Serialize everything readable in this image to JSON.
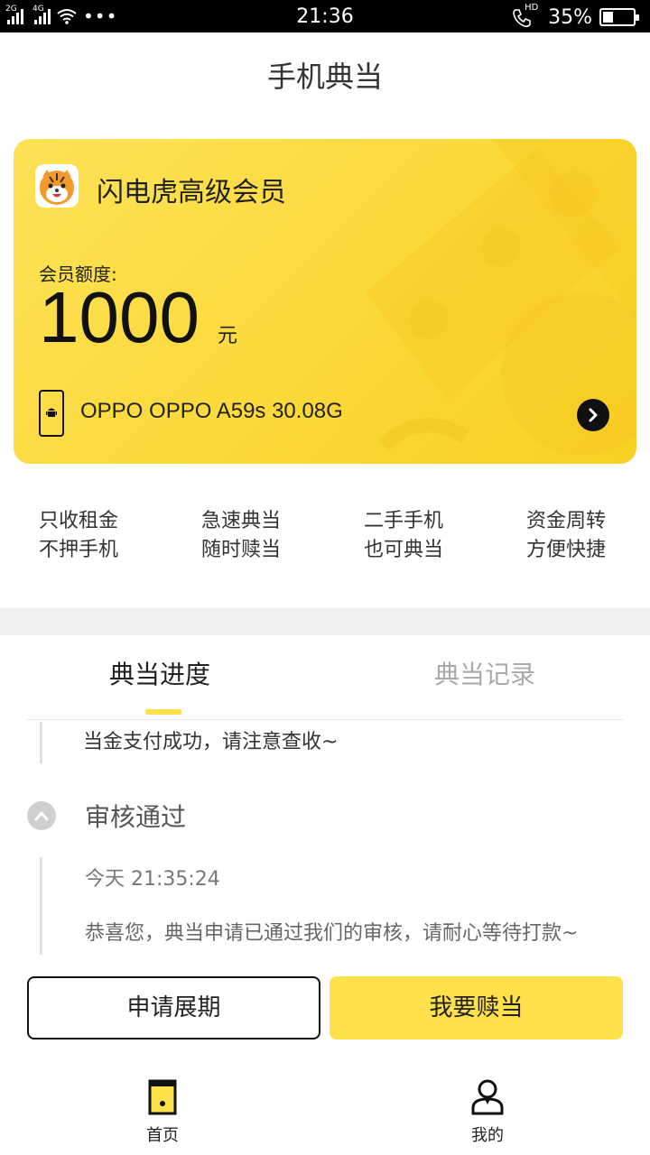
{
  "status_bar": {
    "network_1": "2G",
    "network_2": "4G",
    "dots": "•••",
    "time": "21:36",
    "call_label": "HD",
    "battery": "35%",
    "battery_level": 0.35
  },
  "header": {
    "title": "手机典当"
  },
  "card": {
    "title": "闪电虎高级会员",
    "quota_label": "会员额度:",
    "quota_value": "1000",
    "quota_unit": "元",
    "device": "OPPO OPPO A59s 30.08G",
    "accent": "#fde04a"
  },
  "features": [
    {
      "line1": "只收租金",
      "line2": "不押手机"
    },
    {
      "line1": "急速典当",
      "line2": "随时赎当"
    },
    {
      "line1": "二手手机",
      "line2": "也可典当"
    },
    {
      "line1": "资金周转",
      "line2": "方便快捷"
    }
  ],
  "tabs": [
    {
      "label": "典当进度"
    },
    {
      "label": "典当记录"
    }
  ],
  "timeline": {
    "prev_message": "当金支付成功，请注意查收~",
    "status": "审核通过",
    "time": "今天 21:35:24",
    "description": "恭喜您，典当申请已通过我们的审核，请耐心等待打款~"
  },
  "actions": {
    "extend_label": "申请展期",
    "redeem_label": "我要赎当"
  },
  "bottom_nav": [
    {
      "label": "首页",
      "icon": "phone-home-icon"
    },
    {
      "label": "我的",
      "icon": "person-icon"
    }
  ]
}
